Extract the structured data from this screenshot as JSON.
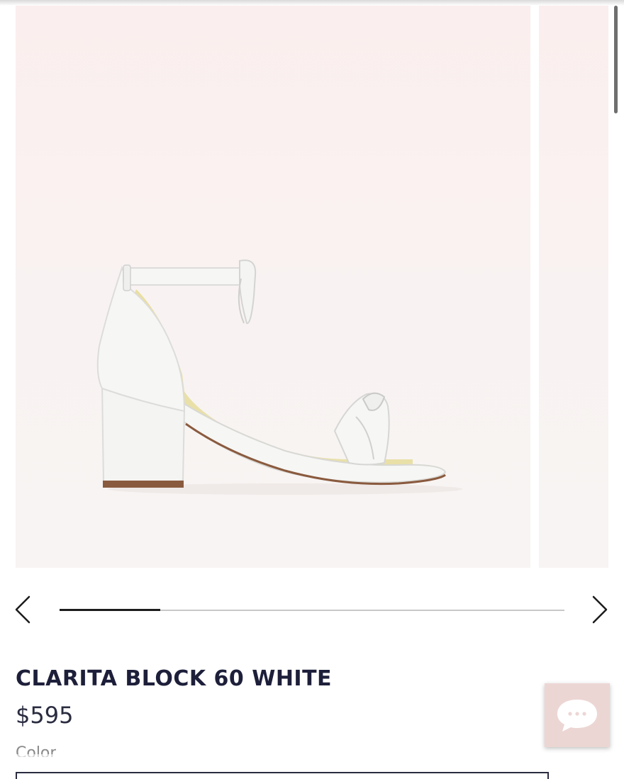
{
  "product": {
    "title": "CLARITA BLOCK 60 WHITE",
    "price": "$595",
    "color_label": "Color"
  },
  "gallery": {
    "slide_progress": 0.2,
    "prev_icon": "chevron-left-icon",
    "next_icon": "chevron-right-icon"
  },
  "chat": {
    "icon": "chat-bubble-icon"
  },
  "colors": {
    "title_text": "#1d1f3a",
    "chat_bg": "#ecd6d4"
  }
}
